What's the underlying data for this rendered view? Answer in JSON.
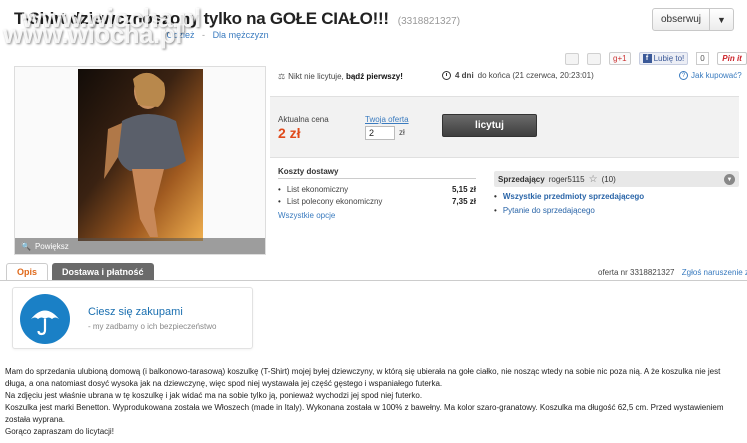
{
  "header": {
    "title_start": "T-Shirt dziewcz",
    "title_end": "noszony tylko na GOŁE CIAŁO!!!",
    "offer_id_inline": "(3318821327)",
    "breadcrumb": [
      "Odzież",
      "Dla mężczyzn"
    ],
    "watch_label": "obserwuj",
    "watch_chevron": "▼"
  },
  "watermark": {
    "line1": "www.wiocha.pl",
    "line2": "www.wiocha.pl"
  },
  "share": {
    "gplus_label": "g+1",
    "fb_like_label": "Lubię to!",
    "fb_count": "0",
    "pin_label": "Pin it"
  },
  "gallery": {
    "enlarge_label": "Powiększ",
    "enlarge_icon": "🔍"
  },
  "auction": {
    "no_bids_text": "Nikt nie licytuje, ",
    "be_first_text": "bądź pierwszy!",
    "bid_icon": "⚖",
    "days_left": "4 dni",
    "days_left_suffix": " do końca (21 czerwca, 20:23:01)",
    "help_link": "Jak kupować?",
    "help_icon": "?",
    "current_price_label": "Aktualna cena",
    "current_price": "2 zł",
    "your_offer_label": "Twoja oferta",
    "offer_value": "2",
    "offer_unit": "zł",
    "bid_button": "licytuj"
  },
  "shipping": {
    "title": "Koszty dostawy",
    "rows": [
      {
        "name": "List ekonomiczny",
        "price": "5,15 zł"
      },
      {
        "name": "List polecony ekonomiczny",
        "price": "7,35 zł"
      }
    ],
    "all_options": "Wszystkie opcje"
  },
  "seller": {
    "label": "Sprzedający",
    "name": "roger5115",
    "rating": "(10)",
    "star_icon": "☆",
    "dropdown_icon": "▼",
    "all_items": "Wszystkie przedmioty sprzedającego",
    "ask_question": "Pytanie do sprzedającego",
    "bullet": "•"
  },
  "tabs": [
    {
      "label": "Opis"
    },
    {
      "label": "Dostawa i płatność"
    }
  ],
  "offer_meta": {
    "offer_no": "oferta nr 3318821327",
    "report": "Zgłoś naruszenie zasad"
  },
  "safe_shopping": {
    "title": "Ciesz się zakupami",
    "subtitle": "my zadbamy o ich bezpieczeństwo"
  },
  "description": [
    "Mam do sprzedania ulubioną domową (i balkonowo-tarasową) koszulkę (T-Shirt) mojej byłej dziewczyny, w którą się ubierała na gołe ciałko, nie nosząc wtedy na sobie nic poza nią. A że koszulka nie jest długa, a ona natomiast dosyć wysoka jak na dziewczynę, więc spod niej wystawała jej część gęstego i wspaniałego futerka.",
    "Na zdjęciu jest właśnie ubrana w tę koszulkę i jak widać ma na sobie tylko ją, ponieważ wychodzi jej spod niej futerko.",
    "Koszulka jest marki Benetton. Wyprodukowana została we Włoszech (made in Italy). Wykonana została w 100% z bawełny. Ma kolor szaro-granatowy. Koszulka ma długość 62,5 cm. Przed wystawieniem została wyprana.",
    "Gorąco zapraszam do licytacji!"
  ],
  "colors": {
    "price": "#e04a1b",
    "link": "#3a7bbf",
    "active_tab": "#e06a1b",
    "umbrella_bg": "#1a80c6"
  }
}
